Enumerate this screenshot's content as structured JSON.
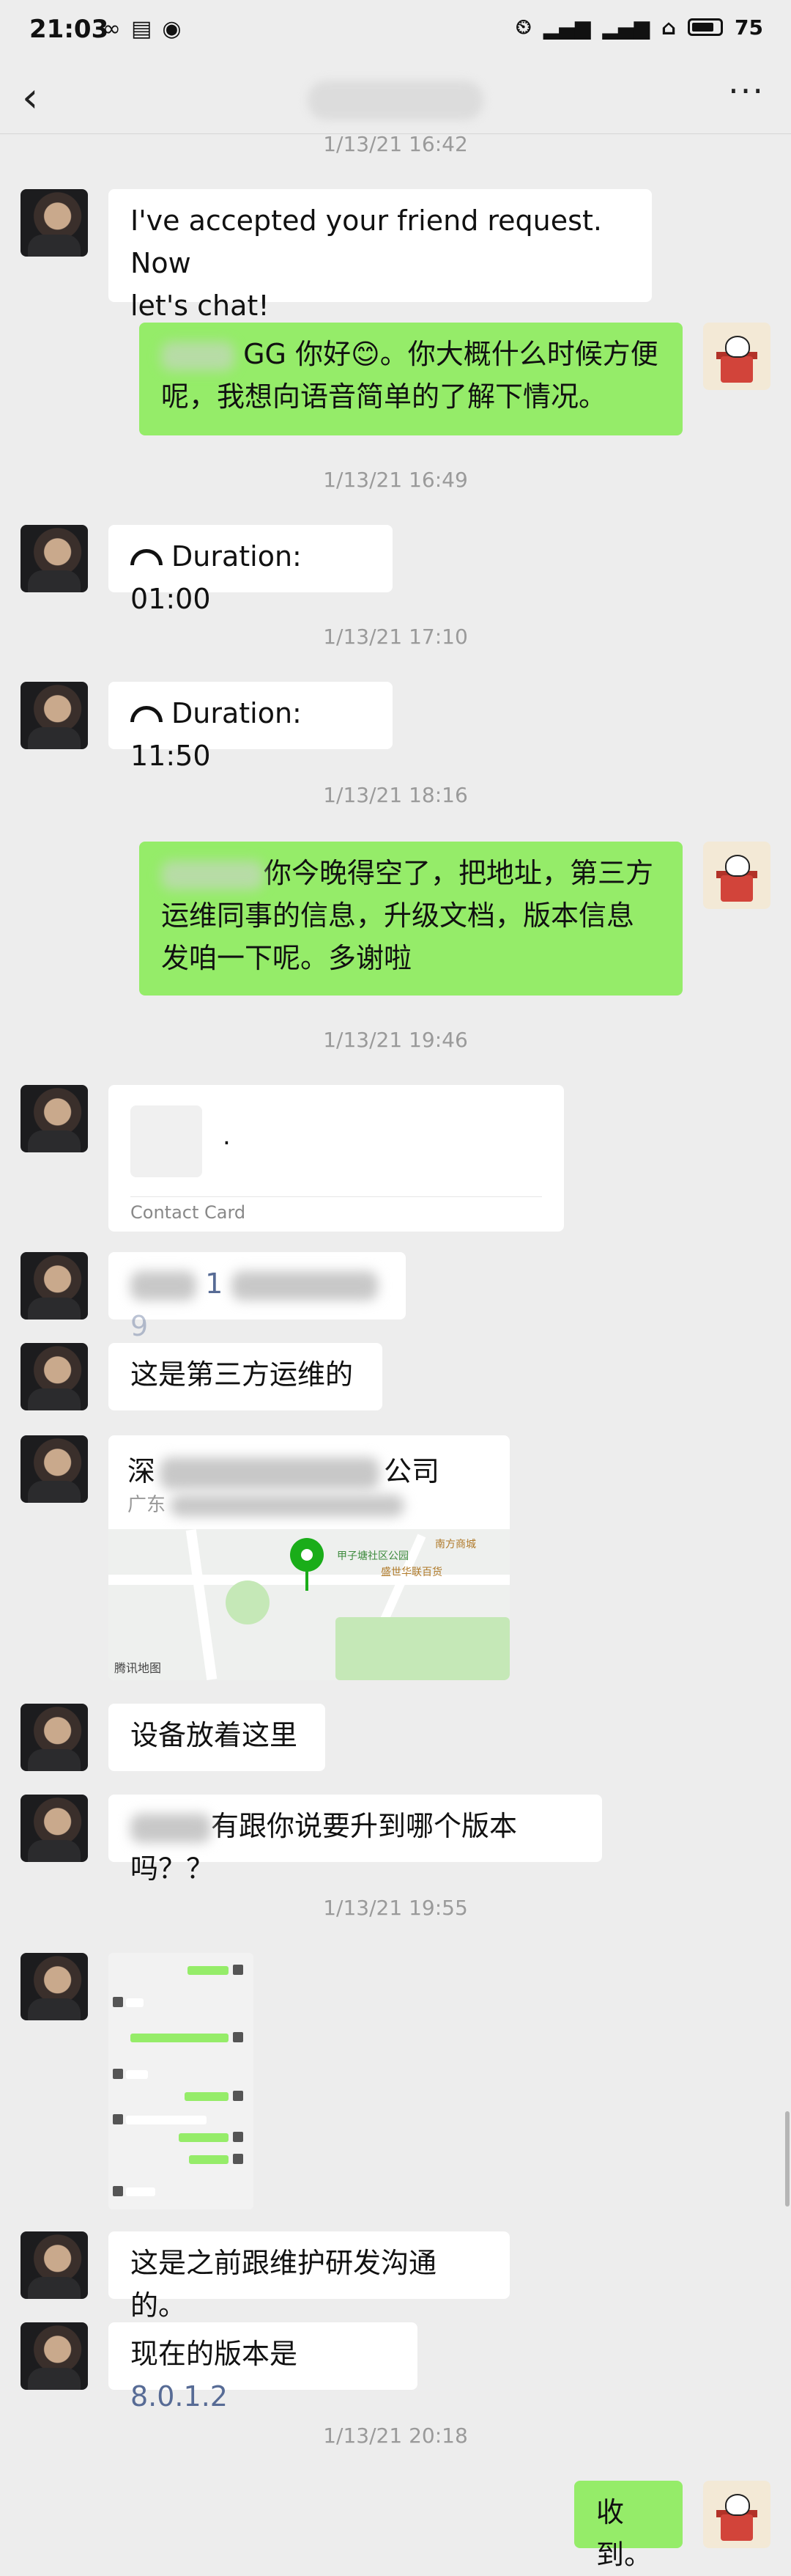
{
  "status": {
    "time": "21:03",
    "battery": "75"
  },
  "nav": {
    "back_icon": "chevron-left-icon",
    "more_icon": "more-dots-icon"
  },
  "timestamps": [
    "1/13/21 16:42",
    "1/13/21 16:49",
    "1/13/21 17:10",
    "1/13/21 18:16",
    "1/13/21 19:46",
    "1/13/21 19:55",
    "1/13/21 20:18"
  ],
  "messages": {
    "m1": {
      "line1": "I've accepted your friend request. Now",
      "line2": "let's chat!"
    },
    "m2": {
      "line1": "GG 你好",
      "emoji": "😊",
      "line1b": "。你大概什么时候方便",
      "line2": "呢，我想向语音简单的了解下情况。"
    },
    "m3": {
      "text": "Duration: 01:00"
    },
    "m4": {
      "text": "Duration: 11:50"
    },
    "m5": {
      "line1": "你今晚得空了，把地址，第三方",
      "line2": "运维同事的信息，升级文档，版本信息",
      "line3": "发咱一下呢。多谢啦"
    },
    "m6": {
      "dot": ".",
      "label": "Contact Card"
    },
    "m7": {
      "digit": "1",
      "tail": "9"
    },
    "m8": {
      "text": "这是第三方运维的"
    },
    "m9": {
      "name_start": "深",
      "name_end": "公司",
      "addr_start": "广东",
      "map_brand": "腾讯地图",
      "poi1": "甲子塘社区公园",
      "poi2": "南方商城",
      "poi3": "盛世华联百货"
    },
    "m10": {
      "text": "设备放着这里"
    },
    "m11": {
      "text": "有跟你说要升到哪个版本吗？？"
    },
    "m13": {
      "text": "这是之前跟维护研发沟通的。"
    },
    "m14": {
      "prefix": "现在的版本是 ",
      "version": "8.0.1.2"
    },
    "m15": {
      "text": "收到。"
    }
  }
}
